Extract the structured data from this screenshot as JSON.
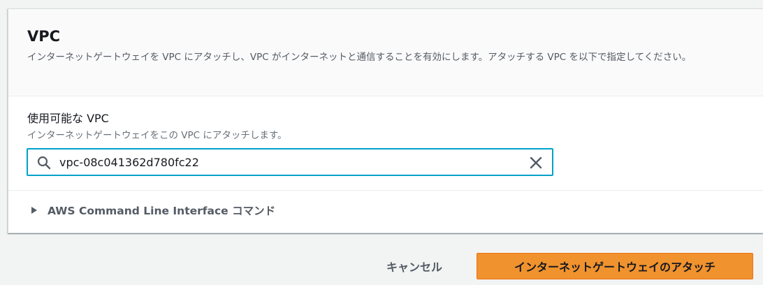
{
  "panel": {
    "title": "VPC",
    "description": "インターネットゲートウェイを VPC にアタッチし、VPC がインターネットと通信することを有効にします。アタッチする VPC を以下で指定してください。"
  },
  "vpc_field": {
    "label": "使用可能な VPC",
    "description": "インターネットゲートウェイをこの VPC にアタッチします。",
    "value": "vpc-08c041362d780fc22",
    "icons": {
      "search": "search-icon",
      "clear": "close-icon"
    }
  },
  "cli_expander": {
    "label": "AWS Command Line Interface コマンド",
    "icon": "caret-right-icon"
  },
  "actions": {
    "cancel_label": "キャンセル",
    "attach_label": "インターネットゲートウェイのアタッチ"
  },
  "colors": {
    "primary": "#f0922e",
    "focus": "#00a1c9",
    "text_secondary": "#545b64"
  }
}
